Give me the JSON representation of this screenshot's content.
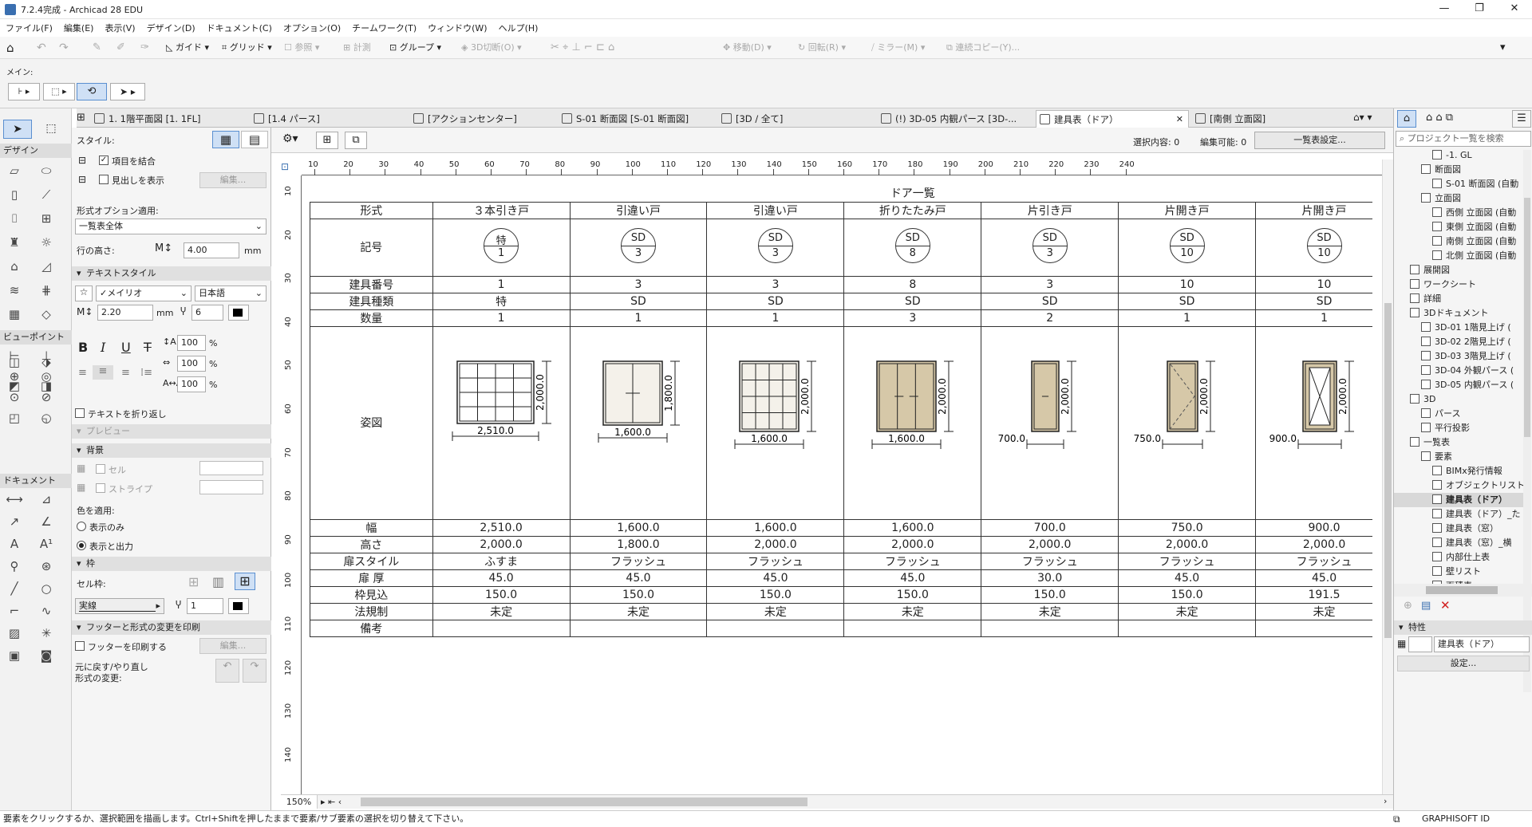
{
  "window": {
    "title": "7.2.4完成 - Archicad 28 EDU",
    "min": "—",
    "max": "❐",
    "close": "✕"
  },
  "menu": [
    "ファイル(F)",
    "編集(E)",
    "表示(V)",
    "デザイン(D)",
    "ドキュメント(C)",
    "オプション(O)",
    "チームワーク(T)",
    "ウィンドウ(W)",
    "ヘルプ(H)"
  ],
  "toolbar": {
    "guide": "ガイド",
    "grid": "グリッド",
    "ref": "参照",
    "calc": "計測",
    "group": "グループ",
    "cut3d": "3D切断(O)",
    "move": "移動(D)",
    "rotate": "回転(R)",
    "mirror": "ミラー(M)",
    "copy": "連続コピー(Y)..."
  },
  "infobox": {
    "main": "メイン:"
  },
  "tabs": [
    "1. 1階平面図 [1. 1FL]",
    "[1.4 パース]",
    "[アクションセンター]",
    "S-01 断面図 [S-01 断面図]",
    "[3D / 全て]",
    "(!) 3D-05 内観パース [3D-...",
    "建具表（ドア）",
    "[南側 立面図]"
  ],
  "toolbox": {
    "design": "デザイン",
    "viewpoint": "ビューポイント",
    "document": "ドキュメント"
  },
  "settings": {
    "style": "スタイル:",
    "merge": "項目を結合",
    "show_header": "見出しを表示",
    "edit": "編集...",
    "format_option": "形式オプション適用:",
    "format_value": "一覧表全体",
    "row_height": "行の高さ:",
    "row_height_val": "4.00",
    "mm": "mm",
    "text_style": "テキストスタイル",
    "font": "✓メイリオ",
    "lang": "日本語",
    "font_size": "2.20",
    "pen": "6",
    "pct1": "100",
    "pct2": "100",
    "pct3": "100",
    "pct": "%",
    "wrap": "テキストを折り返し",
    "preview": "プレビュー",
    "bg": "背景",
    "cell": "セル",
    "stripe": "ストライプ",
    "color_apply": "色を適用:",
    "disp_only": "表示のみ",
    "disp_out": "表示と出力",
    "frame": "枠",
    "cell_frame": "セル枠:",
    "line": "実線",
    "line_pen": "1",
    "footer": "フッターと形式の変更を印刷",
    "print_footer": "フッターを印刷する",
    "edit2": "編集...",
    "undo1": "元に戻す/やり直し",
    "undo2": "形式の変更:"
  },
  "ws": {
    "selection": "選択内容: 0",
    "editable": "編集可能: 0",
    "list_settings": "一覧表設定...",
    "zoom": "150%"
  },
  "ruler": {
    "h": [
      "10",
      "20",
      "30",
      "40",
      "50",
      "60",
      "70",
      "80",
      "90",
      "100",
      "110",
      "120",
      "130",
      "140",
      "150",
      "160",
      "170",
      "180",
      "190",
      "200",
      "210",
      "220",
      "230",
      "240"
    ],
    "v": [
      "10",
      "20",
      "30",
      "40",
      "50",
      "60",
      "70",
      "80",
      "90",
      "100",
      "110",
      "120",
      "130",
      "140"
    ]
  },
  "schedule": {
    "title": "ドア一覧",
    "labels": {
      "type": "形式",
      "sym": "記号",
      "num": "建具番号",
      "kind": "建具種類",
      "qty": "数量",
      "fig": "姿図",
      "w": "幅",
      "h": "高さ",
      "leaf": "扉スタイル",
      "thick": "扉 厚",
      "frame": "枠見込",
      "law": "法規制",
      "note": "備考"
    },
    "cols": [
      {
        "type": "３本引き戸",
        "st": "特",
        "sb": "1",
        "num": "1",
        "kind": "特",
        "qty": "1",
        "w": "2,510.0",
        "h": "2,000.0",
        "leaf": "ふすま",
        "thick": "45.0",
        "frame": "150.0",
        "law": "未定",
        "dw": "2,510.0",
        "dh": "2,000.0"
      },
      {
        "type": "引違い戸",
        "st": "SD",
        "sb": "3",
        "num": "3",
        "kind": "SD",
        "qty": "1",
        "w": "1,600.0",
        "h": "1,800.0",
        "leaf": "フラッシュ",
        "thick": "45.0",
        "frame": "150.0",
        "law": "未定",
        "dw": "1,600.0",
        "dh": "1,800.0"
      },
      {
        "type": "引違い戸",
        "st": "SD",
        "sb": "3",
        "num": "3",
        "kind": "SD",
        "qty": "1",
        "w": "1,600.0",
        "h": "2,000.0",
        "leaf": "フラッシュ",
        "thick": "45.0",
        "frame": "150.0",
        "law": "未定",
        "dw": "1,600.0",
        "dh": "2,000.0"
      },
      {
        "type": "折りたたみ戸",
        "st": "SD",
        "sb": "8",
        "num": "8",
        "kind": "SD",
        "qty": "3",
        "w": "1,600.0",
        "h": "2,000.0",
        "leaf": "フラッシュ",
        "thick": "45.0",
        "frame": "150.0",
        "law": "未定",
        "dw": "1,600.0",
        "dh": "2,000.0"
      },
      {
        "type": "片引き戸",
        "st": "SD",
        "sb": "3",
        "num": "3",
        "kind": "SD",
        "qty": "2",
        "w": "700.0",
        "h": "2,000.0",
        "leaf": "フラッシュ",
        "thick": "30.0",
        "frame": "150.0",
        "law": "未定",
        "dw": "700.0",
        "dh": "2,000.0"
      },
      {
        "type": "片開き戸",
        "st": "SD",
        "sb": "10",
        "num": "10",
        "kind": "SD",
        "qty": "1",
        "w": "750.0",
        "h": "2,000.0",
        "leaf": "フラッシュ",
        "thick": "45.0",
        "frame": "150.0",
        "law": "未定",
        "dw": "750.0",
        "dh": "2,000.0"
      },
      {
        "type": "片開き戸",
        "st": "SD",
        "sb": "10",
        "num": "10",
        "kind": "SD",
        "qty": "1",
        "w": "900.0",
        "h": "2,000.0",
        "leaf": "フラッシュ",
        "thick": "45.0",
        "frame": "191.5",
        "law": "未定",
        "dw": "900.0",
        "dh": "2,000.0"
      }
    ]
  },
  "nav": {
    "search": "プロジェクト一覧を検索",
    "items": [
      "-1. GL",
      "断面図",
      "S-01 断面図 (自動",
      "立面図",
      "西側 立面図 (自動",
      "東側 立面図 (自動",
      "南側 立面図 (自動",
      "北側 立面図 (自動",
      "展開図",
      "ワークシート",
      "詳細",
      "3Dドキュメント",
      "3D-01 1階見上げ (",
      "3D-02 2階見上げ (",
      "3D-03 3階見上げ (",
      "3D-04 外観パース (",
      "3D-05 内観パース (",
      "3D",
      "パース",
      "平行投影",
      "一覧表",
      "要素",
      "BIMx発行情報",
      "オブジェクトリスト",
      "建具表（ドア）",
      "建具表（ドア）_た",
      "建具表（窓）",
      "建具表（窓）_横",
      "内部仕上表",
      "壁リスト",
      "面積表"
    ],
    "prop": "特性",
    "prop_val": "建具表（ドア）",
    "settings": "設定..."
  },
  "status": {
    "msg": "要素をクリックするか、選択範囲を描画します。Ctrl+Shiftを押したままで要素/サブ要素の選択を切り替えて下さい。",
    "brand": "GRAPHISOFT ID"
  }
}
